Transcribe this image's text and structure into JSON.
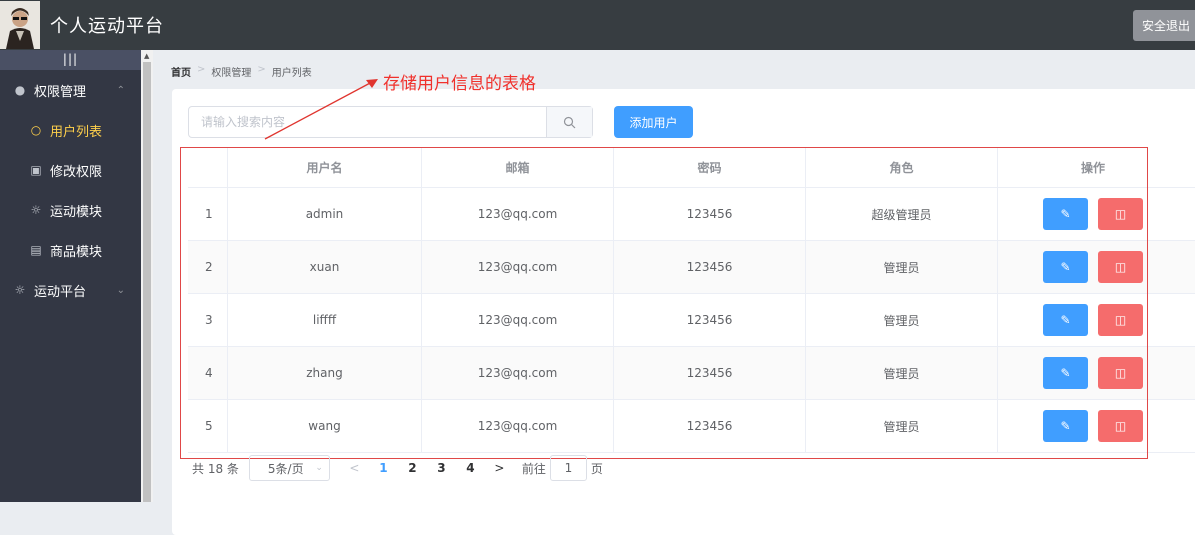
{
  "header": {
    "title": "个人运动平台",
    "logout_label": "安全退出"
  },
  "sidebar": {
    "toggle_label": "|||",
    "items": [
      {
        "label": "权限管理",
        "icon": "user-icon",
        "level": "top",
        "arrow": "⌃"
      },
      {
        "label": "用户列表",
        "icon": "user-outline-icon",
        "level": "sub",
        "active": true
      },
      {
        "label": "修改权限",
        "icon": "lock-icon",
        "level": "sub"
      },
      {
        "label": "运动模块",
        "icon": "sun-icon",
        "level": "sub"
      },
      {
        "label": "商品模块",
        "icon": "bag-icon",
        "level": "sub"
      },
      {
        "label": "运动平台",
        "icon": "sun-icon",
        "level": "top",
        "arrow": "⌄"
      }
    ]
  },
  "breadcrumb": {
    "home": "首页",
    "sep": ">",
    "level1": "权限管理",
    "level2": "用户列表"
  },
  "annotation": {
    "text": "存储用户信息的表格",
    "color": "#f0312c"
  },
  "search": {
    "placeholder": "请输入搜索内容",
    "button_icon": "search-icon"
  },
  "add_button_label": "添加用户",
  "table": {
    "columns": [
      "",
      "用户名",
      "邮箱",
      "密码",
      "角色",
      "操作"
    ],
    "rows": [
      {
        "index": "1",
        "username": "admin",
        "email": "123@qq.com",
        "password": "123456",
        "role": "超级管理员"
      },
      {
        "index": "2",
        "username": "xuan",
        "email": "123@qq.com",
        "password": "123456",
        "role": "管理员"
      },
      {
        "index": "3",
        "username": "liffff",
        "email": "123@qq.com",
        "password": "123456",
        "role": "管理员"
      },
      {
        "index": "4",
        "username": "zhang",
        "email": "123@qq.com",
        "password": "123456",
        "role": "管理员"
      },
      {
        "index": "5",
        "username": "wang",
        "email": "123@qq.com",
        "password": "123456",
        "role": "管理员"
      }
    ]
  },
  "pagination": {
    "total": "共 18 条",
    "page_size": "5条/页",
    "prev": "<",
    "pages": [
      "1",
      "2",
      "3",
      "4"
    ],
    "current": "1",
    "next": ">",
    "goto_prefix": "前往",
    "goto_value": "1",
    "goto_suffix": "页"
  },
  "colors": {
    "primary": "#409eff",
    "danger": "#f56c6c",
    "header_bg": "#373d41",
    "sidebar_bg": "#333744",
    "active": "#ffd04b"
  }
}
